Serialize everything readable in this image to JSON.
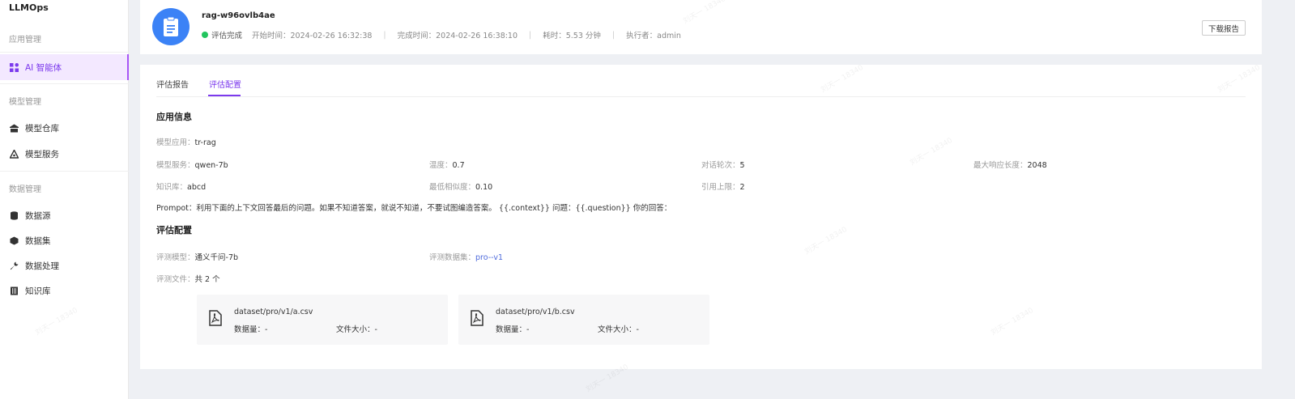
{
  "sidebar": {
    "logo": "LLMOps",
    "groups": {
      "app": "应用管理",
      "model": "模型管理",
      "data": "数据管理"
    },
    "items": {
      "agent": "AI 智能体",
      "model_repo": "模型仓库",
      "model_service": "模型服务",
      "data_source": "数据源",
      "dataset": "数据集",
      "data_processing": "数据处理",
      "knowledge_base": "知识库"
    }
  },
  "header": {
    "title": "rag-w96ovlb4ae",
    "status": "评估完成",
    "start_time": "开始时间：2024-02-26 16:32:38",
    "end_time": "完成时间：2024-02-26 16:38:10",
    "duration": "耗时：5.53 分钟",
    "executor": "执行者：admin",
    "download_label": "下载报告",
    "colors": {
      "status": "#22c55e",
      "accent": "#7c3aed",
      "avatar": "#3b82f6"
    }
  },
  "tabs": {
    "report": "评估报告",
    "config": "评估配置"
  },
  "app_info": {
    "title": "应用信息",
    "model_app_label": "模型应用：",
    "model_app": "tr-rag",
    "model_service_label": "模型服务：",
    "model_service": "qwen-7b",
    "temperature_label": "温度：",
    "temperature": "0.7",
    "dialog_rounds_label": "对话轮次：",
    "dialog_rounds": "5",
    "max_length_label": "最大响应长度：",
    "max_length": "2048",
    "knowledge_label": "知识库：",
    "knowledge": "abcd",
    "min_similarity_label": "最低相似度：",
    "min_similarity": "0.10",
    "cite_limit_label": "引用上限：",
    "cite_limit": "2",
    "prompt_label": "Prompot：",
    "prompt": "利用下面的上下文回答最后的问题。如果不知道答案，就说不知道，不要试图编造答案。 {{.context}} 问题：{{.question}} 你的回答："
  },
  "eval_config": {
    "title": "评估配置",
    "eval_model_label": "评测模型：",
    "eval_model": "通义千问-7b",
    "eval_dataset_label": "评测数据集：",
    "eval_dataset": "pro--v1",
    "eval_files_label": "评测文件：",
    "eval_files": "共 2 个",
    "files": [
      {
        "name": "dataset/pro/v1/a.csv",
        "count": "数据量：-",
        "size": "文件大小：-"
      },
      {
        "name": "dataset/pro/v1/b.csv",
        "count": "数据量：-",
        "size": "文件大小：-"
      }
    ]
  },
  "watermark": "刘天一 18340"
}
